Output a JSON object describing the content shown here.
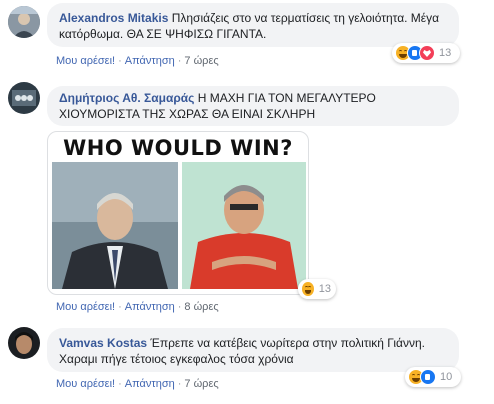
{
  "comments": [
    {
      "author": "Alexandros Mitakis",
      "text": "Πλησιάζεις στο να τερματίσεις τη γελοιότητα. Μέγα κατόρθωμα. ΘΑ ΣΕ ΨΗΦΙΣΩ ΓΙΓΑΝΤΑ.",
      "like_label": "Μου αρέσει!",
      "reply_label": "Απάντηση",
      "time": "7 ώρες",
      "reaction_count": "13",
      "reactions": [
        "haha-icon",
        "like-icon",
        "love-icon"
      ]
    },
    {
      "author": "Δημήτριος Αθ. Σαμαράς",
      "text": "Η ΜΑΧΗ ΓΙΑ ΤΟΝ ΜΕΓΑΛΥΤΕΡΟ ΧΙΟΥΜΟΡΙΣΤΑ ΤΗΣ ΧΩΡΑΣ ΘΑ ΕΙΝΑΙ ΣΚΛΗΡΗ",
      "image_title": "WHO WOULD WIN?",
      "like_label": "Μου αρέσει!",
      "reply_label": "Απάντηση",
      "time": "8 ώρες",
      "reaction_count": "13",
      "reactions": [
        "haha-icon"
      ]
    },
    {
      "author": "Vamvas Kostas",
      "text": "Έπρεπε να κατέβεις νωρίτερα στην πολιτική Γιάννη. Χαραμι πήγε τέτοιος εγκεφαλος τόσα χρόνια",
      "like_label": "Μου αρέσει!",
      "reply_label": "Απάντηση",
      "time": "7 ώρες",
      "reaction_count": "10",
      "reactions": [
        "haha-icon",
        "like-icon"
      ]
    }
  ],
  "colors": {
    "author": "#385898",
    "bubble": "#f2f3f5",
    "link": "#4267b2",
    "meta": "#90949c"
  }
}
